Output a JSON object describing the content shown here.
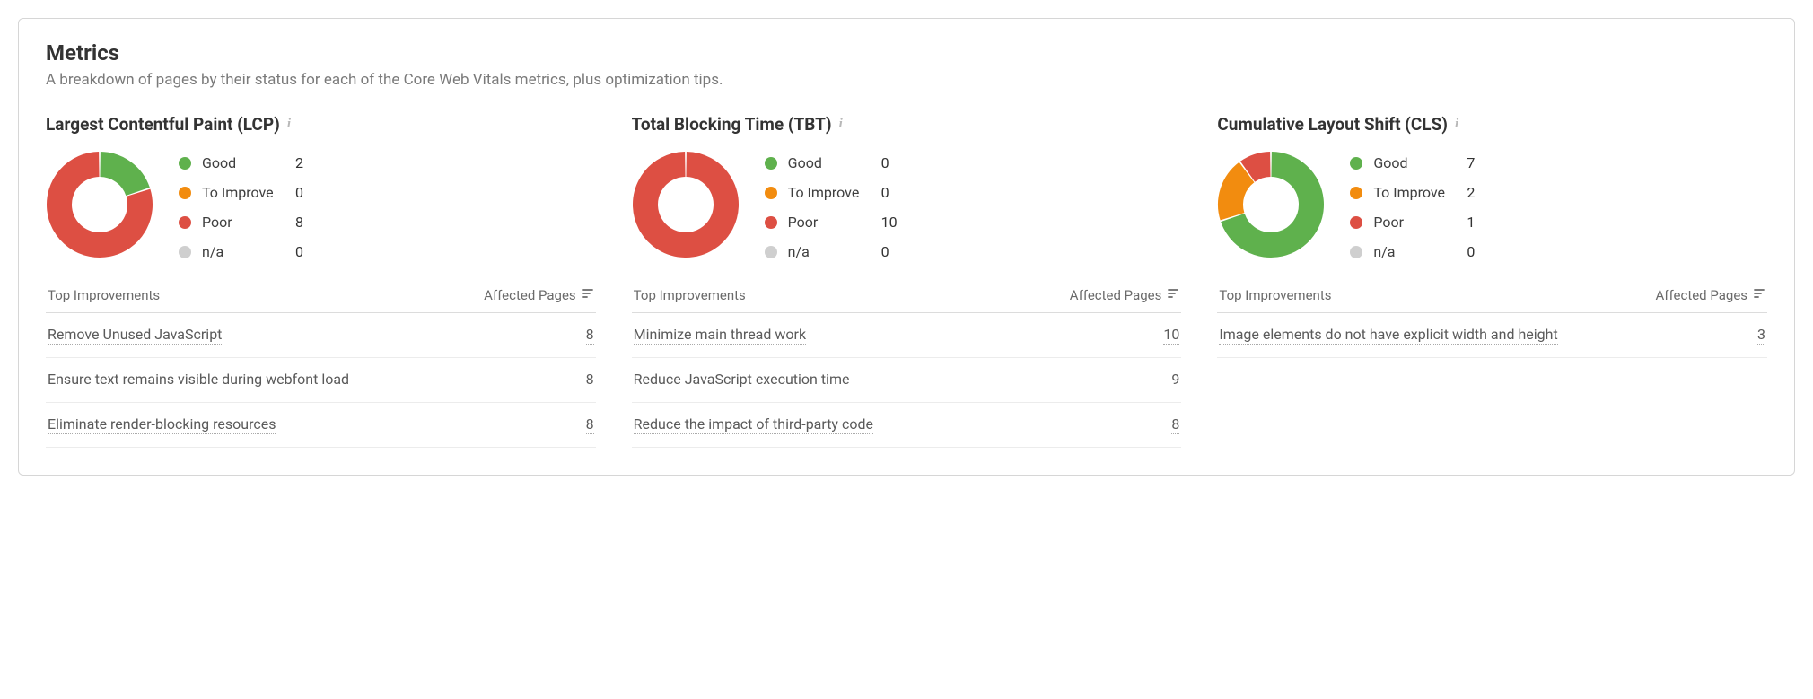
{
  "panel": {
    "title": "Metrics",
    "subtitle": "A breakdown of pages by their status for each of the Core Web Vitals metrics, plus optimization tips."
  },
  "colors": {
    "good": "#5fb14d",
    "improve": "#f28c0f",
    "poor": "#dd4f43",
    "na": "#cfcfcf"
  },
  "legend_labels": {
    "good": "Good",
    "improve": "To Improve",
    "poor": "Poor",
    "na": "n/a"
  },
  "table_headers": {
    "left": "Top Improvements",
    "right": "Affected Pages"
  },
  "metrics": [
    {
      "title": "Largest Contentful Paint (LCP)",
      "good": 2,
      "improve": 0,
      "poor": 8,
      "na": 0,
      "improvements": [
        {
          "name": "Remove Unused JavaScript",
          "count": 8
        },
        {
          "name": "Ensure text remains visible during webfont load",
          "count": 8
        },
        {
          "name": "Eliminate render-blocking resources",
          "count": 8
        }
      ]
    },
    {
      "title": "Total Blocking Time (TBT)",
      "good": 0,
      "improve": 0,
      "poor": 10,
      "na": 0,
      "improvements": [
        {
          "name": "Minimize main thread work",
          "count": 10
        },
        {
          "name": "Reduce JavaScript execution time",
          "count": 9
        },
        {
          "name": "Reduce the impact of third-party code",
          "count": 8
        }
      ]
    },
    {
      "title": "Cumulative Layout Shift (CLS)",
      "good": 7,
      "improve": 2,
      "poor": 1,
      "na": 0,
      "improvements": [
        {
          "name": "Image elements do not have explicit width and height",
          "count": 3
        }
      ]
    }
  ],
  "chart_data": [
    {
      "type": "pie",
      "title": "Largest Contentful Paint (LCP)",
      "series": [
        {
          "name": "Good",
          "value": 2
        },
        {
          "name": "To Improve",
          "value": 0
        },
        {
          "name": "Poor",
          "value": 8
        },
        {
          "name": "n/a",
          "value": 0
        }
      ]
    },
    {
      "type": "pie",
      "title": "Total Blocking Time (TBT)",
      "series": [
        {
          "name": "Good",
          "value": 0
        },
        {
          "name": "To Improve",
          "value": 0
        },
        {
          "name": "Poor",
          "value": 10
        },
        {
          "name": "n/a",
          "value": 0
        }
      ]
    },
    {
      "type": "pie",
      "title": "Cumulative Layout Shift (CLS)",
      "series": [
        {
          "name": "Good",
          "value": 7
        },
        {
          "name": "To Improve",
          "value": 2
        },
        {
          "name": "Poor",
          "value": 1
        },
        {
          "name": "n/a",
          "value": 0
        }
      ]
    }
  ]
}
